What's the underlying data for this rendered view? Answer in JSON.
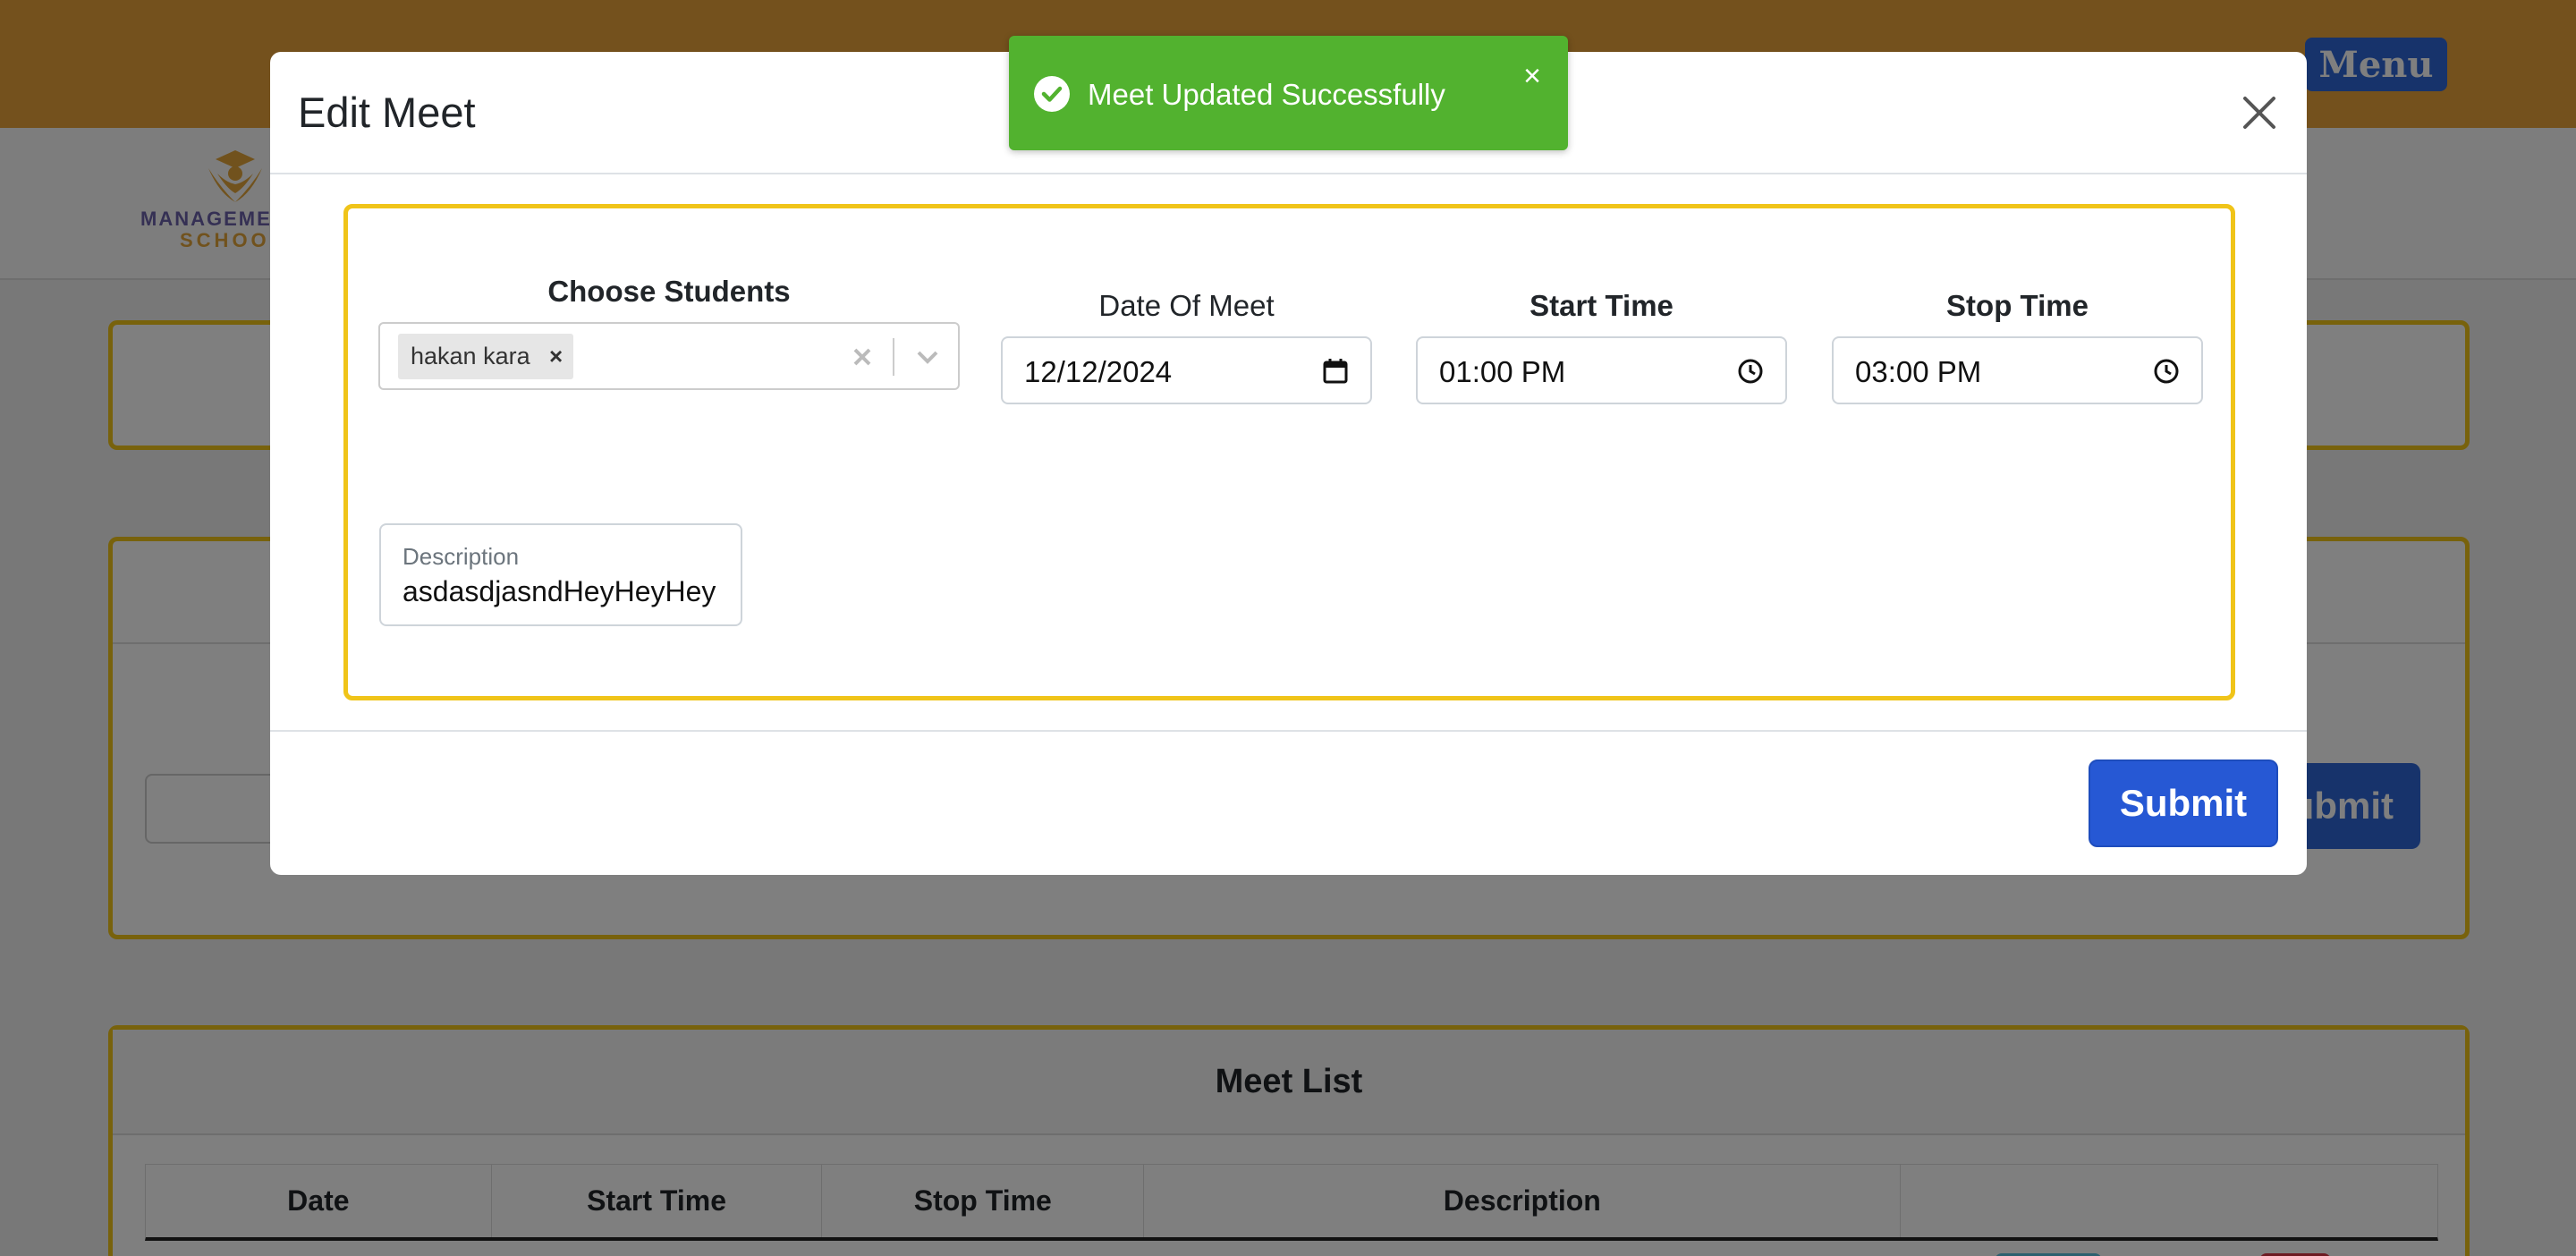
{
  "header": {
    "menu_label": "Menu"
  },
  "brand": {
    "line1": "MANAGEMENT",
    "line2": "SCHOOL"
  },
  "background_form": {
    "submit_label": "Submit"
  },
  "meet_list": {
    "title": "Meet List",
    "columns": [
      "Date",
      "Start Time",
      "Stop Time",
      "Description",
      ""
    ]
  },
  "toast": {
    "message": "Meet Updated Successfully"
  },
  "modal": {
    "title": "Edit Meet",
    "choose_students_label": "Choose Students",
    "selected_students": [
      "hakan kara"
    ],
    "date_label": "Date Of Meet",
    "date_value": "12/12/2024",
    "start_time_label": "Start Time",
    "start_time_value": "01:00 PM",
    "stop_time_label": "Stop Time",
    "stop_time_value": "03:00 PM",
    "description_label": "Description",
    "description_value": "asdasdjasndHeyHeyHey",
    "submit_label": "Submit"
  },
  "colors": {
    "topbar": "#e9a23b",
    "accent_border": "#f0c419",
    "primary_button": "#2658d4",
    "toast_success": "#52b22f"
  },
  "icons": [
    "check-circle-icon",
    "close-icon",
    "calendar-icon",
    "clock-icon",
    "chevron-down-icon",
    "clear-icon"
  ]
}
